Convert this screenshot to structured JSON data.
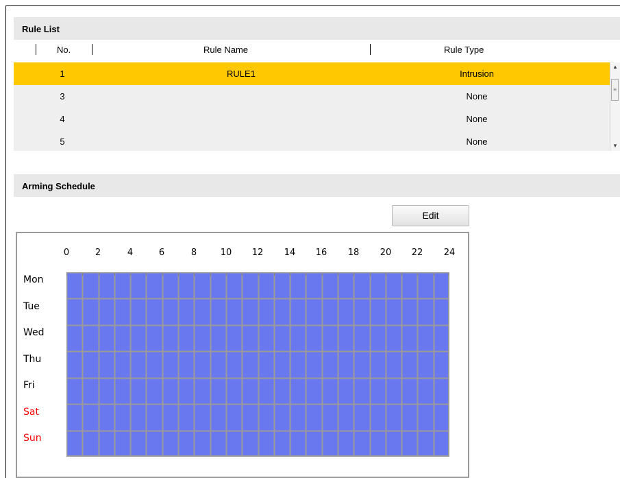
{
  "rule_list": {
    "title": "Rule List",
    "columns": {
      "no": "No.",
      "name": "Rule Name",
      "type": "Rule Type"
    },
    "rows": [
      {
        "no": "1",
        "name": "RULE1",
        "type": "Intrusion",
        "selected": true
      },
      {
        "no": "3",
        "name": "",
        "type": "None",
        "selected": false
      },
      {
        "no": "4",
        "name": "",
        "type": "None",
        "selected": false
      },
      {
        "no": "5",
        "name": "",
        "type": "None",
        "selected": false
      }
    ],
    "scrollbar": {
      "up_icon": "triangle-up",
      "down_icon": "triangle-down",
      "thumb_icon": "grip"
    }
  },
  "arming_schedule": {
    "title": "Arming Schedule",
    "edit_label": "Edit",
    "hours": [
      "0",
      "2",
      "4",
      "6",
      "8",
      "10",
      "12",
      "14",
      "16",
      "18",
      "20",
      "22",
      "24"
    ],
    "days": [
      {
        "label": "Mon",
        "weekend": false
      },
      {
        "label": "Tue",
        "weekend": false
      },
      {
        "label": "Wed",
        "weekend": false
      },
      {
        "label": "Thu",
        "weekend": false
      },
      {
        "label": "Fri",
        "weekend": false
      },
      {
        "label": "Sat",
        "weekend": true
      },
      {
        "label": "Sun",
        "weekend": true
      }
    ],
    "armed_coverage": "all days, 0-24",
    "colors": {
      "armed": "#6a78f0",
      "grid_line": "#9a9a9a",
      "weekend_label": "#ff0000"
    }
  },
  "colors": {
    "selected_row": "#ffc800",
    "row_bg": "#efefef",
    "header_bg": "#e8e8e8"
  }
}
